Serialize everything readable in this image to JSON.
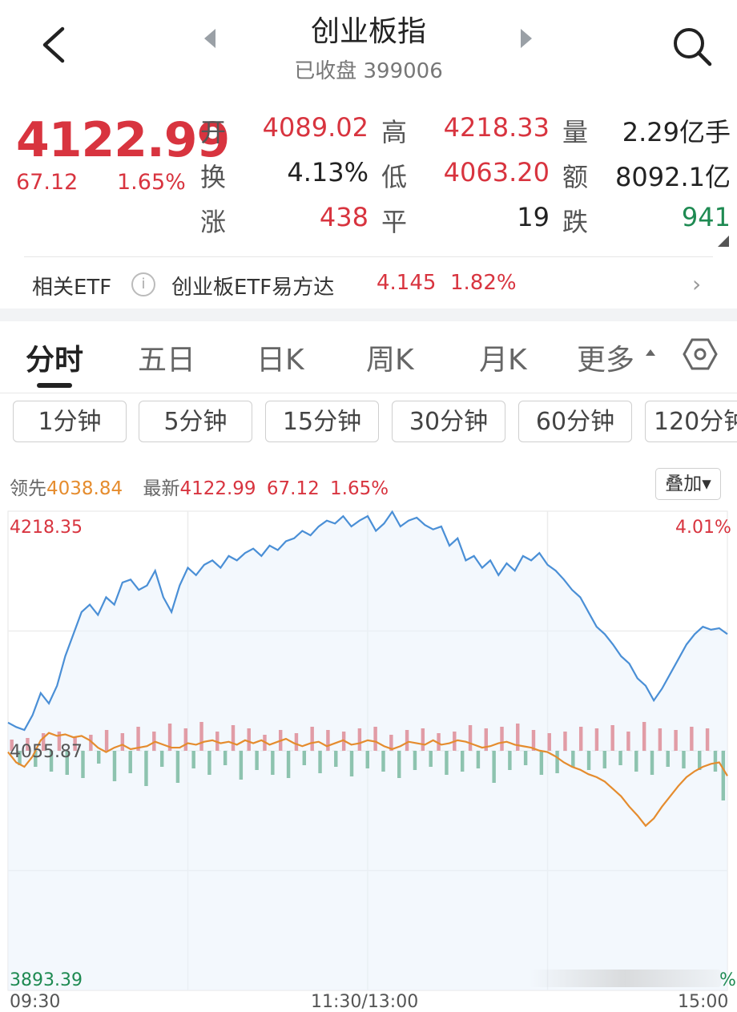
{
  "header": {
    "back_icon": "chevron-left-icon",
    "title": "创业板指",
    "subtitle": "已收盘 399006",
    "search_icon": "search-icon"
  },
  "quote": {
    "price": "4122.99",
    "change": "67.12",
    "change_pct": "1.65%",
    "open_label": "开",
    "open": "4089.02",
    "high_label": "高",
    "high": "4218.33",
    "volume_label": "量",
    "volume": "2.29亿手",
    "turnover_label": "换",
    "turnover": "4.13%",
    "low_label": "低",
    "low": "4063.20",
    "amount_label": "额",
    "amount": "8092.1亿",
    "up_label": "涨",
    "up": "438",
    "flat_label": "平",
    "flat": "19",
    "down_label": "跌",
    "down": "941"
  },
  "etf": {
    "label": "相关ETF",
    "name": "创业板ETF易方达",
    "price": "4.145",
    "pct": "1.82%"
  },
  "tabs": {
    "items": [
      "分时",
      "五日",
      "日K",
      "周K",
      "月K",
      "更多"
    ],
    "active": "分时"
  },
  "periods": [
    "1分钟",
    "5分钟",
    "15分钟",
    "30分钟",
    "60分钟",
    "120分钟"
  ],
  "legend": {
    "lead_label": "领先",
    "lead_value": "4038.84",
    "latest_label": "最新",
    "latest_value": "4122.99",
    "latest_change": "67.12",
    "latest_pct": "1.65%",
    "overlay_label": "叠加"
  },
  "colors": {
    "up": "#d8343f",
    "down": "#1e8a52",
    "price_line": "#4a8fd6",
    "lead_line": "#e58c2e"
  },
  "chart_data": {
    "type": "line",
    "y_top_label": "4218.35",
    "y_mid_label": "4055.87",
    "y_bottom_label": "3893.39",
    "pct_top_label": "4.01%",
    "pct_bottom_label": "%",
    "x_labels": [
      "09:30",
      "11:30/13:00",
      "15:00"
    ],
    "ylim": [
      3893.39,
      4218.35
    ],
    "prev_close": 4055.87,
    "series": [
      {
        "name": "最新",
        "values": [
          4075,
          4072,
          4070,
          4080,
          4095,
          4088,
          4100,
          4120,
          4135,
          4150,
          4155,
          4148,
          4160,
          4155,
          4170,
          4172,
          4165,
          4168,
          4178,
          4160,
          4150,
          4168,
          4180,
          4175,
          4182,
          4185,
          4180,
          4188,
          4185,
          4190,
          4193,
          4188,
          4195,
          4192,
          4198,
          4200,
          4205,
          4202,
          4208,
          4212,
          4210,
          4215,
          4208,
          4212,
          4215,
          4205,
          4210,
          4218,
          4208,
          4212,
          4214,
          4209,
          4206,
          4208,
          4195,
          4200,
          4185,
          4188,
          4180,
          4185,
          4175,
          4183,
          4178,
          4188,
          4185,
          4190,
          4182,
          4178,
          4172,
          4165,
          4160,
          4150,
          4140,
          4135,
          4128,
          4120,
          4115,
          4105,
          4100,
          4090,
          4098,
          4108,
          4118,
          4128,
          4135,
          4140,
          4138,
          4139,
          4135
        ]
      },
      {
        "name": "领先",
        "values": [
          4055,
          4048,
          4045,
          4052,
          4063,
          4068,
          4066,
          4067,
          4065,
          4066,
          4063,
          4058,
          4055,
          4058,
          4060,
          4057,
          4058,
          4059,
          4062,
          4060,
          4058,
          4058,
          4061,
          4060,
          4062,
          4063,
          4061,
          4062,
          4060,
          4063,
          4061,
          4063,
          4060,
          4062,
          4064,
          4061,
          4059,
          4061,
          4062,
          4059,
          4061,
          4063,
          4060,
          4061,
          4063,
          4062,
          4059,
          4057,
          4059,
          4062,
          4061,
          4060,
          4063,
          4060,
          4061,
          4063,
          4062,
          4060,
          4058,
          4059,
          4061,
          4062,
          4060,
          4059,
          4058,
          4056,
          4055,
          4052,
          4048,
          4045,
          4043,
          4040,
          4038,
          4035,
          4030,
          4025,
          4018,
          4012,
          4005,
          4010,
          4018,
          4025,
          4032,
          4038,
          4042,
          4045,
          4047,
          4048,
          4038.84
        ]
      }
    ],
    "volume_bars": [
      14,
      -18,
      16,
      -20,
      22,
      -26,
      24,
      -30,
      18,
      -34,
      20,
      -16,
      26,
      -38,
      22,
      -28,
      30,
      -44,
      24,
      -20,
      34,
      -40,
      28,
      -22,
      36,
      -30,
      24,
      -18,
      32,
      -36,
      28,
      -24,
      20,
      -30,
      26,
      -34,
      22,
      -18,
      30,
      -28,
      26,
      -20,
      24,
      -32,
      28,
      -22,
      30,
      -26,
      20,
      -34,
      26,
      -24,
      28,
      -20,
      22,
      -30,
      24,
      -26,
      32,
      -22,
      28,
      -40,
      30,
      -24,
      34,
      -18,
      26,
      -30,
      22,
      -28,
      24,
      -20,
      30,
      -24,
      28,
      -22,
      32,
      -18,
      24,
      -26,
      36,
      -30,
      28,
      -20,
      26,
      -22,
      30,
      -24,
      28,
      -26,
      -62
    ]
  }
}
